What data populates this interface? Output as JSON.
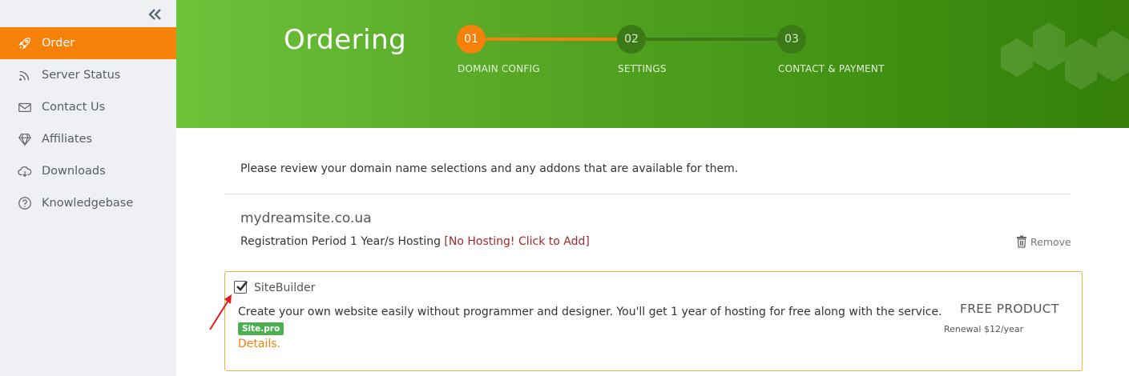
{
  "sidebar": {
    "collapse_icon": "double-chevron-left-icon",
    "items": [
      {
        "label": "Order",
        "icon": "rocket-icon",
        "active": true
      },
      {
        "label": "Server Status",
        "icon": "rss-icon",
        "active": false
      },
      {
        "label": "Contact Us",
        "icon": "envelope-icon",
        "active": false
      },
      {
        "label": "Affiliates",
        "icon": "diamond-icon",
        "active": false
      },
      {
        "label": "Downloads",
        "icon": "cloud-download-icon",
        "active": false
      },
      {
        "label": "Knowledgebase",
        "icon": "question-circle-icon",
        "active": false
      }
    ]
  },
  "header": {
    "title": "Ordering",
    "steps": [
      {
        "number": "01",
        "label": "DOMAIN CONFIG",
        "active": true
      },
      {
        "number": "02",
        "label": "SETTINGS",
        "active": false
      },
      {
        "number": "03",
        "label": "CONTACT & PAYMENT",
        "active": false
      }
    ]
  },
  "main": {
    "intro": "Please review your domain name selections and any addons that are available for them.",
    "domain": {
      "name": "mydreamsite.co.ua",
      "registration_text": "Registration Period 1 Year/s Hosting ",
      "no_hosting_link": "[No Hosting! Click to Add]",
      "remove_label": "Remove"
    },
    "addon": {
      "checked": true,
      "name": "SiteBuilder",
      "description": "Create your own website easily without programmer and designer. You'll get 1 year of hosting for free along with the service.",
      "badge": "Site.pro",
      "details_link": "Details.",
      "price_label": "FREE PRODUCT",
      "renewal": "Renewal $12/year"
    }
  },
  "colors": {
    "accent_orange": "#f5800a",
    "banner_green": "#4e9e1e",
    "badge_green": "#4caf50",
    "link_red": "#a0282c",
    "addon_border": "#f0b03a"
  }
}
